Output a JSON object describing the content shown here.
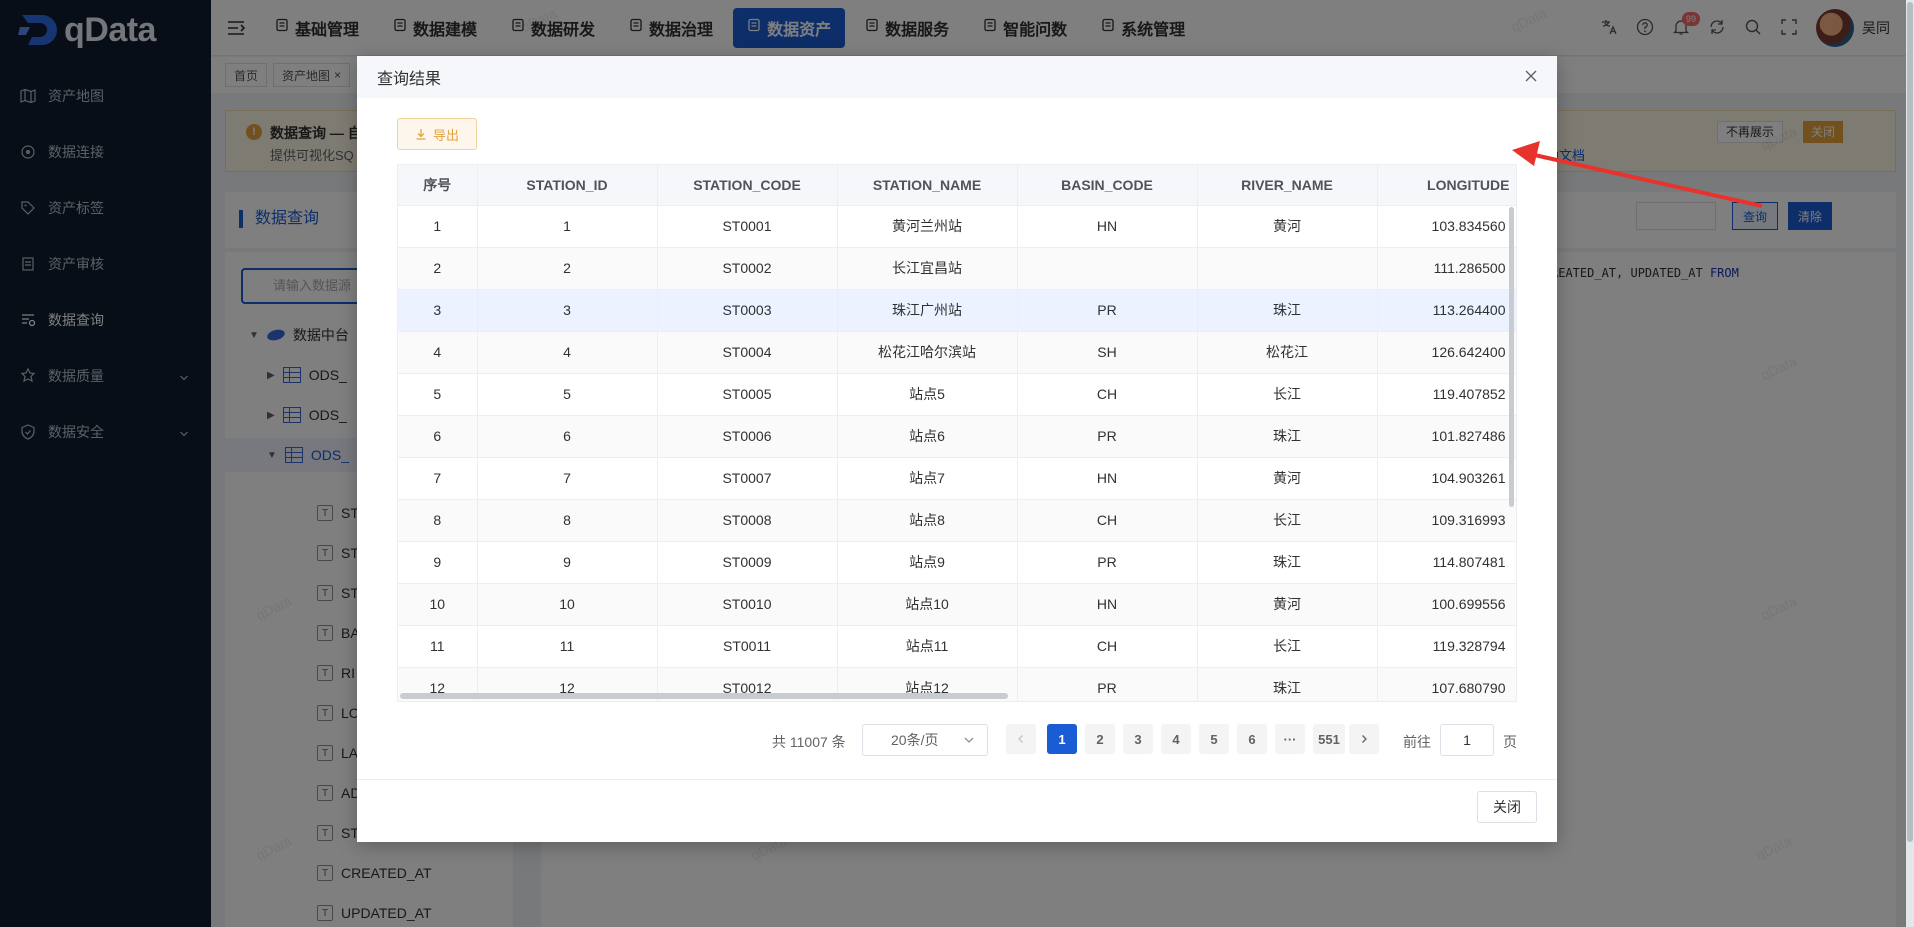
{
  "app": {
    "logo_text": "qData"
  },
  "sidebar": {
    "items": [
      {
        "label": "资产地图",
        "icon": "map-icon"
      },
      {
        "label": "数据连接",
        "icon": "link-icon"
      },
      {
        "label": "资产标签",
        "icon": "tag-icon"
      },
      {
        "label": "资产审核",
        "icon": "audit-icon"
      },
      {
        "label": "数据查询",
        "icon": "query-icon",
        "active": true
      },
      {
        "label": "数据质量",
        "icon": "quality-icon",
        "expandable": true
      },
      {
        "label": "数据安全",
        "icon": "shield-icon",
        "expandable": true
      }
    ]
  },
  "topnav": {
    "tabs": [
      {
        "label": "基础管理",
        "icon": "doc-icon"
      },
      {
        "label": "数据建模",
        "icon": "cube-icon"
      },
      {
        "label": "数据研发",
        "icon": "cube-icon"
      },
      {
        "label": "数据治理",
        "icon": "image-icon"
      },
      {
        "label": "数据资产",
        "icon": "asset-icon",
        "active": true
      },
      {
        "label": "数据服务",
        "icon": "heart-icon"
      },
      {
        "label": "智能问数",
        "icon": "robot-icon"
      },
      {
        "label": "系统管理",
        "icon": "gear-icon"
      }
    ],
    "user_name": "吴同",
    "notification_count": "99"
  },
  "tags": [
    {
      "label": "首页"
    },
    {
      "label": "资产地图",
      "closable": true
    }
  ],
  "notice": {
    "title": "数据查询 — 自",
    "subtitle": "提供可视化SQ",
    "dismiss_label": "不再展示",
    "close_label": "关闭",
    "help_link": "助文档"
  },
  "panel": {
    "title": "数据查询",
    "query_label": "查询",
    "clear_label": "清除",
    "search_placeholder": "请输入数据源"
  },
  "tree": {
    "root": "数据中台",
    "tables": [
      "ODS_",
      "ODS_",
      "ODS_"
    ],
    "fields": [
      "ST",
      "ST",
      "ST",
      "BA",
      "RI",
      "LC",
      "LA",
      "AD",
      "ST",
      "CREATED_AT",
      "UPDATED_AT"
    ]
  },
  "editor": {
    "sql_text": "REATED_AT, UPDATED_AT ",
    "sql_keyword": "FROM"
  },
  "dialog": {
    "title": "查询结果",
    "export_label": "导出",
    "close_label": "关闭",
    "columns": [
      "序号",
      "STATION_ID",
      "STATION_CODE",
      "STATION_NAME",
      "BASIN_CODE",
      "RIVER_NAME",
      "LONGITUDE"
    ],
    "rows": [
      [
        "1",
        "1",
        "ST0001",
        "黄河兰州站",
        "HN",
        "黄河",
        "103.834560"
      ],
      [
        "2",
        "2",
        "ST0002",
        "长江宜昌站",
        "",
        "",
        "111.286500"
      ],
      [
        "3",
        "3",
        "ST0003",
        "珠江广州站",
        "PR",
        "珠江",
        "113.264400"
      ],
      [
        "4",
        "4",
        "ST0004",
        "松花江哈尔滨站",
        "SH",
        "松花江",
        "126.642400"
      ],
      [
        "5",
        "5",
        "ST0005",
        "站点5",
        "CH",
        "长江",
        "119.407852"
      ],
      [
        "6",
        "6",
        "ST0006",
        "站点6",
        "PR",
        "珠江",
        "101.827486"
      ],
      [
        "7",
        "7",
        "ST0007",
        "站点7",
        "HN",
        "黄河",
        "104.903261"
      ],
      [
        "8",
        "8",
        "ST0008",
        "站点8",
        "CH",
        "长江",
        "109.316993"
      ],
      [
        "9",
        "9",
        "ST0009",
        "站点9",
        "PR",
        "珠江",
        "114.807481"
      ],
      [
        "10",
        "10",
        "ST0010",
        "站点10",
        "HN",
        "黄河",
        "100.699556"
      ],
      [
        "11",
        "11",
        "ST0011",
        "站点11",
        "CH",
        "长江",
        "119.328794"
      ],
      [
        "12",
        "12",
        "ST0012",
        "站点12",
        "PR",
        "珠江",
        "107.680790"
      ]
    ],
    "highlighted_row": 3,
    "pagination": {
      "total_label": "共 11007 条",
      "page_size": "20条/页",
      "pages": [
        "1",
        "2",
        "3",
        "4",
        "5",
        "6",
        "···",
        "551"
      ],
      "current_page": "1",
      "goto_label": "前往",
      "goto_value": "1",
      "page_suffix": "页"
    }
  },
  "watermark_text": "qData",
  "colors": {
    "primary": "#1a5cd3",
    "sidebar_bg": "#0f1c2e",
    "export": "#e6a23c",
    "arrow": "#e8322c"
  }
}
